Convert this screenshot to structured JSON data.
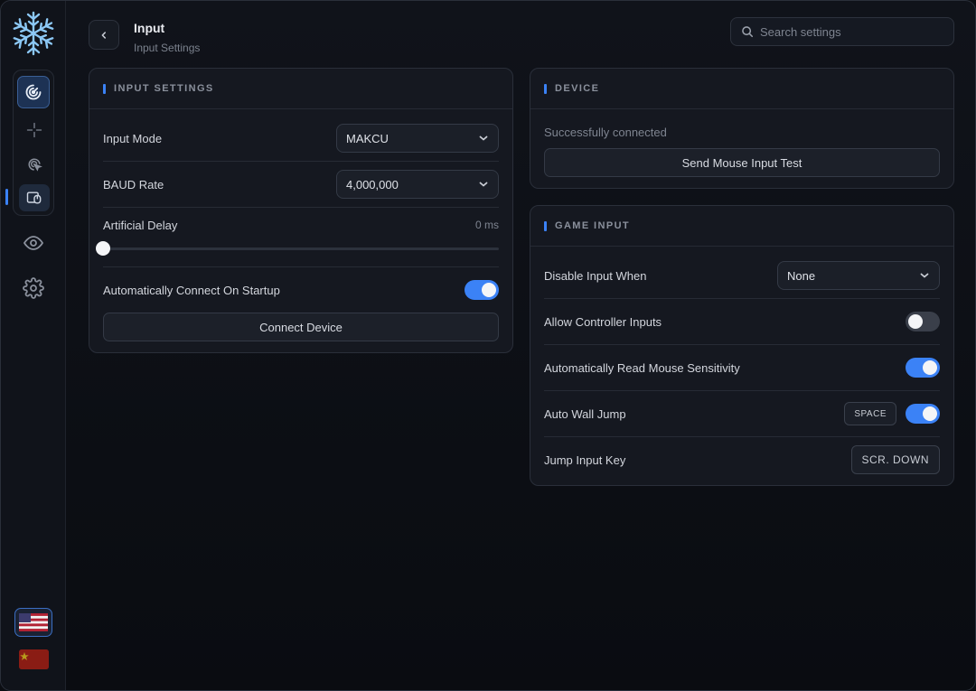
{
  "header": {
    "title": "Input",
    "subtitle": "Input Settings"
  },
  "search": {
    "placeholder": "Search settings"
  },
  "icons": {
    "logo": "snowflake-logo",
    "nav": [
      "radar-icon",
      "crosshair-icon",
      "target-cursor-icon",
      "device-mouse-icon"
    ],
    "side": [
      "eye-icon",
      "gear-icon"
    ],
    "flags": [
      "us-flag",
      "cn-flag"
    ]
  },
  "colors": {
    "accent": "#3b82f6",
    "background": "#0b0d12",
    "card": "#151820"
  },
  "input_settings": {
    "title": "INPUT SETTINGS",
    "input_mode": {
      "label": "Input Mode",
      "value": "MAKCU"
    },
    "baud_rate": {
      "label": "BAUD Rate",
      "value": "4,000,000"
    },
    "artificial_delay": {
      "label": "Artificial Delay",
      "value_text": "0 ms",
      "value": 0
    },
    "auto_connect": {
      "label": "Automatically Connect On Startup",
      "enabled": true
    },
    "connect_button": "Connect Device"
  },
  "device": {
    "title": "DEVICE",
    "status": "Successfully connected",
    "test_button": "Send Mouse Input Test"
  },
  "game_input": {
    "title": "GAME INPUT",
    "disable_input_when": {
      "label": "Disable Input When",
      "value": "None"
    },
    "allow_controller": {
      "label": "Allow Controller Inputs",
      "enabled": false
    },
    "auto_read_sensitivity": {
      "label": "Automatically Read Mouse Sensitivity",
      "enabled": true
    },
    "auto_wall_jump": {
      "label": "Auto Wall Jump",
      "key": "SPACE",
      "enabled": true
    },
    "jump_input_key": {
      "label": "Jump Input Key",
      "key": "SCR. DOWN"
    }
  }
}
